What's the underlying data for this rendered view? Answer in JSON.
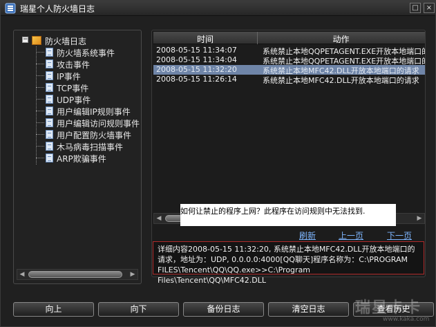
{
  "window": {
    "title": "瑞星个人防火墙日志",
    "restore_glyph": "□",
    "close_glyph": "×"
  },
  "tree": {
    "expander_glyph": "−",
    "root_label": "防火墙日志",
    "items": [
      "防火墙系统事件",
      "攻击事件",
      "IP事件",
      "TCP事件",
      "UDP事件",
      "用户编辑IP规则事件",
      "用户编辑访问规则事件",
      "用户配置防火墙事件",
      "木马病毒扫描事件",
      "ARP欺骗事件"
    ]
  },
  "table": {
    "headers": {
      "time": "时间",
      "action": "动作"
    },
    "rows": [
      {
        "time": "2008-05-15 11:34:07",
        "action": "系统禁止本地QQPETAGENT.EXE开放本地端口的"
      },
      {
        "time": "2008-05-15 11:34:04",
        "action": "系统禁止本地QQPETAGENT.EXE开放本地端口的"
      },
      {
        "time": "2008-05-15 11:32:20",
        "action": "系统禁止本地MFC42.DLL开放本地端口的请求"
      },
      {
        "time": "2008-05-15 11:26:14",
        "action": "系统禁止本地MFC42.DLL开放本地端口的请求"
      }
    ],
    "selected_index": 2
  },
  "scrollbar": {
    "left_arrow": "◀",
    "right_arrow": "▶"
  },
  "tooltip": {
    "text": "如何让禁止的程序上网？此程序在访问规则中无法找到."
  },
  "nav": {
    "refresh": "刷新",
    "prev": "上一页",
    "next": "下一页"
  },
  "detail": {
    "text": "详细内容2008-05-15 11:32:20, 系统禁止本地MFC42.DLL开放本地端口的请求，地址为：UDP, 0.0.0.0:4000[QQ聊天]程序名称为：C:\\PROGRAM FILES\\Tencent\\QQ\\QQ.exe>>C:\\Program Files\\Tencent\\QQ\\MFC42.DLL"
  },
  "buttons": {
    "up": "向上",
    "down": "向下",
    "backup": "备份日志",
    "clear": "清空日志",
    "history": "查看历史"
  },
  "watermark": {
    "big": "瑞星卡卡",
    "small": "www.kaka.com"
  },
  "colors": {
    "selected_row": "#6f85a8",
    "link": "#7eb6ff",
    "detail_border": "#b02a2a"
  }
}
